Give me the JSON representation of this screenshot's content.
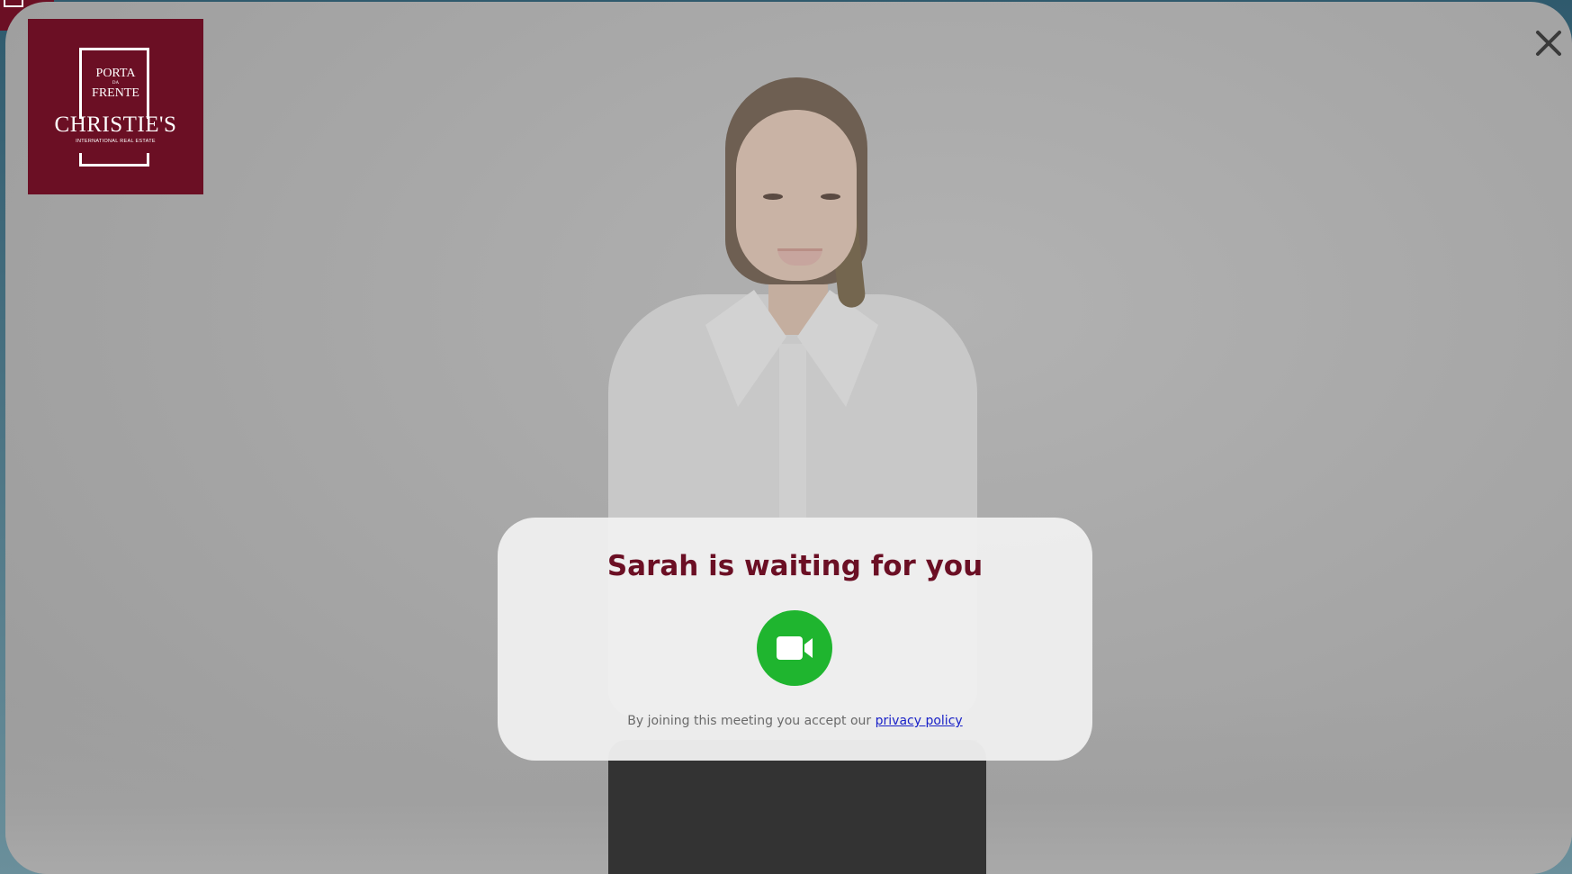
{
  "logo": {
    "line1": "PORTA",
    "line2": "DA",
    "line3": "FRENTE",
    "brand": "CHRISTIE'S",
    "tagline": "INTERNATIONAL REAL ESTATE"
  },
  "dialog": {
    "title": "Sarah is waiting for you",
    "join_icon": "video-camera-icon",
    "consent_text": "By joining this meeting you accept our",
    "privacy_link": "privacy policy"
  },
  "icons": {
    "close": "close-icon"
  },
  "colors": {
    "brand": "#6b0f24",
    "join_button": "#1fb52f",
    "link": "#1a22c8"
  }
}
